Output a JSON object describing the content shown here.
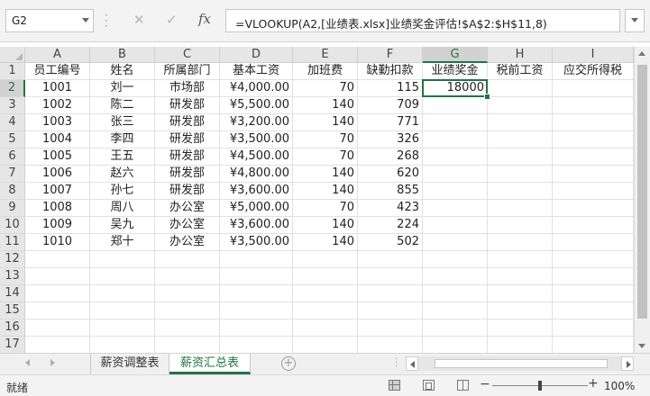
{
  "formula_bar": {
    "name_box": "G2",
    "cancel_glyph": "✕",
    "enter_glyph": "✓",
    "fx_label": "fx",
    "formula": "=VLOOKUP(A2,[业绩表.xlsx]业绩奖金评估!$A$2:$H$11,8)"
  },
  "columns": [
    "A",
    "B",
    "C",
    "D",
    "E",
    "F",
    "G",
    "H",
    "I"
  ],
  "selected_column": "G",
  "selected_row": 2,
  "selected_cell": "G2",
  "row_numbers": [
    "1",
    "2",
    "3",
    "4",
    "5",
    "6",
    "7",
    "8",
    "9",
    "10",
    "11",
    "12",
    "13",
    "14",
    "15",
    "16",
    "17"
  ],
  "cells": [
    [
      "员工编号",
      "姓名",
      "所属部门",
      "基本工资",
      "加班费",
      "缺勤扣款",
      "业绩奖金",
      "税前工资",
      "应交所得税"
    ],
    [
      "1001",
      "刘一",
      "市场部",
      "¥4,000.00",
      "70",
      "115",
      "18000",
      "",
      ""
    ],
    [
      "1002",
      "陈二",
      "研发部",
      "¥5,500.00",
      "140",
      "709",
      "",
      "",
      ""
    ],
    [
      "1003",
      "张三",
      "研发部",
      "¥3,200.00",
      "140",
      "771",
      "",
      "",
      ""
    ],
    [
      "1004",
      "李四",
      "研发部",
      "¥3,500.00",
      "70",
      "326",
      "",
      "",
      ""
    ],
    [
      "1005",
      "王五",
      "研发部",
      "¥4,500.00",
      "70",
      "268",
      "",
      "",
      ""
    ],
    [
      "1006",
      "赵六",
      "研发部",
      "¥4,800.00",
      "140",
      "620",
      "",
      "",
      ""
    ],
    [
      "1007",
      "孙七",
      "研发部",
      "¥3,600.00",
      "140",
      "855",
      "",
      "",
      ""
    ],
    [
      "1008",
      "周八",
      "办公室",
      "¥5,000.00",
      "70",
      "423",
      "",
      "",
      ""
    ],
    [
      "1009",
      "吴九",
      "办公室",
      "¥3,600.00",
      "140",
      "224",
      "",
      "",
      ""
    ],
    [
      "1010",
      "郑十",
      "办公室",
      "¥3,500.00",
      "140",
      "502",
      "",
      "",
      ""
    ],
    [
      "",
      "",
      "",
      "",
      "",
      "",
      "",
      "",
      ""
    ],
    [
      "",
      "",
      "",
      "",
      "",
      "",
      "",
      "",
      ""
    ],
    [
      "",
      "",
      "",
      "",
      "",
      "",
      "",
      "",
      ""
    ],
    [
      "",
      "",
      "",
      "",
      "",
      "",
      "",
      "",
      ""
    ],
    [
      "",
      "",
      "",
      "",
      "",
      "",
      "",
      "",
      ""
    ],
    [
      "",
      "",
      "",
      "",
      "",
      "",
      "",
      "",
      ""
    ]
  ],
  "sheet_tabs": [
    {
      "label": "薪资调整表",
      "active": false
    },
    {
      "label": "薪资汇总表",
      "active": true
    }
  ],
  "add_sheet_glyph": "+",
  "status": {
    "ready": "就绪",
    "zoom_out_glyph": "−",
    "zoom_in_glyph": "+",
    "zoom_text": "100%",
    "zoom_level": 100
  },
  "view_buttons": [
    {
      "name": "normal-view-icon",
      "active": true
    },
    {
      "name": "page-layout-view-icon",
      "active": false
    },
    {
      "name": "page-break-preview-icon",
      "active": false
    }
  ]
}
